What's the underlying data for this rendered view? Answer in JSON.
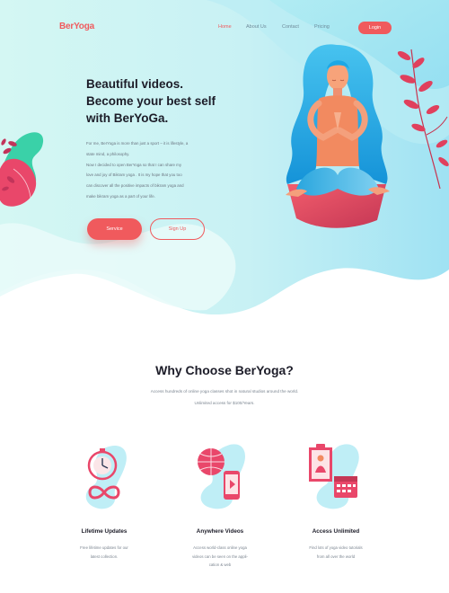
{
  "header": {
    "logo": "BerYoga",
    "nav": [
      {
        "label": "Home",
        "active": true
      },
      {
        "label": "About Us",
        "active": false
      },
      {
        "label": "Contact",
        "active": false
      },
      {
        "label": "Pricing",
        "active": false
      }
    ],
    "login_label": "Login"
  },
  "hero": {
    "title_lines": [
      "Beautiful videos.",
      "Become your best self",
      "with BerYoGa."
    ],
    "text_lines": [
      "For me, BerYoga is more than just a sport – it is lifestyle, a",
      "state mind, a philosophy.",
      "Now I decided to open BerYoga so that I can share my",
      "love and joy of Bikram yoga . It is my hope that you too",
      "can discover all the positive impacts of bikram yoga and",
      "make bikram yoga as a part of your life."
    ],
    "service_label": "Service",
    "signup_label": "Sign Up"
  },
  "why": {
    "title": "Why Choose BerYoga?",
    "sub_line1": "Access hundreds of online yoga classes shot in natural studios around the world.",
    "sub_line2": "Unlimited access for $100/Years."
  },
  "features": [
    {
      "icon": "stopwatch-infinity-icon",
      "title": "Lifetime Updates",
      "desc_lines": [
        "Free lifetime updates for our",
        "latest collection."
      ]
    },
    {
      "icon": "globe-phone-video-icon",
      "title": "Anywhere Videos",
      "desc_lines": [
        "Access world-class online yoga",
        "videos can be seen on the appli-",
        "cation & web"
      ]
    },
    {
      "icon": "calendar-yoga-icon",
      "title": "Access Unlimited",
      "desc_lines": [
        "Find lots of yoga video tutorials",
        "from all over the world"
      ]
    }
  ],
  "colors": {
    "accent": "#f05a5d",
    "hero_bg_light": "#dff8f6",
    "hero_bg_blue": "#9fe6f2",
    "hair_blue": "#1ba8e6",
    "plant_pink": "#e9476a"
  }
}
